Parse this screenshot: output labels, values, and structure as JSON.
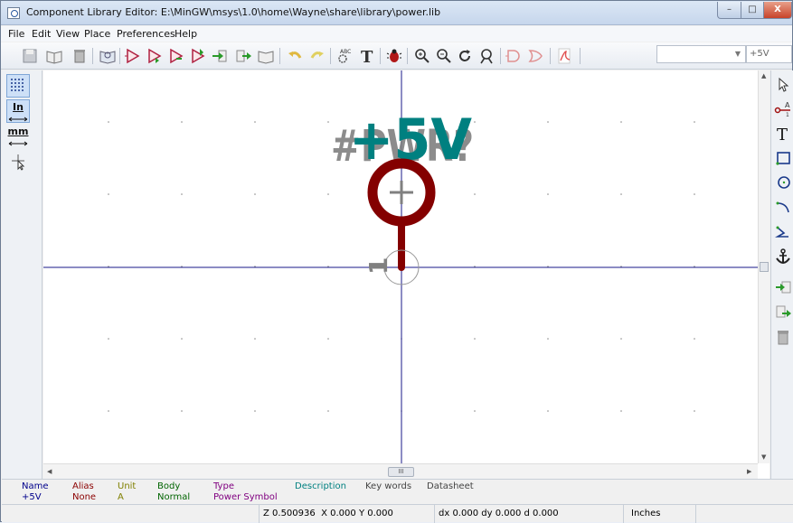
{
  "window": {
    "title": "Component Library Editor: E:\\MinGW\\msys\\1.0\\home\\Wayne\\share\\library\\power.lib",
    "controls": [
      "–",
      "□",
      "X"
    ]
  },
  "menu": [
    "File",
    "Edit",
    "View",
    "Place",
    "Preferences",
    "Help"
  ],
  "toolbar": {
    "icons": [
      "save-library-icon",
      "open-library-icon",
      "delete-part-icon",
      "library-browser-icon",
      "new-part-icon",
      "import-part-icon",
      "export-part-icon",
      "save-part-icon",
      "import-arrow-icon",
      "export-arrow-icon",
      "save-current-icon",
      "undo-icon",
      "redo-icon",
      "edit-fields-icon",
      "text-icon",
      "bug-check-icon",
      "zoom-in-icon",
      "zoom-out-icon",
      "redraw-icon",
      "zoom-fit-icon",
      "deMorgan-normal-icon",
      "deMorgan-convert-icon",
      "pdf-doc-icon"
    ],
    "part_select": "",
    "alias_select": "+5V",
    "abc_label": "ABC"
  },
  "left_toolbar": {
    "items": [
      {
        "icon": "grid-toggle-icon",
        "active": true
      },
      {
        "icon": "inch-units-icon",
        "label": "In",
        "active": true
      },
      {
        "icon": "mm-units-icon",
        "label": "mm",
        "active": false
      },
      {
        "icon": "cursor-shape-icon",
        "active": false
      }
    ]
  },
  "right_toolbar": {
    "icons": [
      "select-arrow-icon",
      "add-pin-icon",
      "add-text-icon",
      "add-rectangle-icon",
      "add-circle-icon",
      "add-arc-icon",
      "add-polyline-icon",
      "set-anchor-icon",
      "import-drawing-icon",
      "export-drawing-icon",
      "delete-item-icon"
    ],
    "text_glyph": "T",
    "pin_glyph": "A",
    "pin_number": "1"
  },
  "canvas": {
    "value_text": "+5V",
    "reference_text": "#PWR?",
    "pin_number": "1",
    "colors": {
      "value": "#008080",
      "body": "#840000",
      "reference": "#808080",
      "axis": "#1a1a8a",
      "grid": "#888888"
    }
  },
  "message_panel": {
    "columns": [
      {
        "header": "Name",
        "value": "+5V",
        "header_color": "#00008b",
        "value_color": "#00008b"
      },
      {
        "header": "Alias",
        "value": "None",
        "header_color": "#8b0000",
        "value_color": "#8b0000"
      },
      {
        "header": "Unit",
        "value": "A",
        "header_color": "#808000",
        "value_color": "#808000"
      },
      {
        "header": "Body",
        "value": "Normal",
        "header_color": "#006400",
        "value_color": "#006400"
      },
      {
        "header": "Type",
        "value": "Power Symbol",
        "header_color": "#800080",
        "value_color": "#800080"
      },
      {
        "header": "Description",
        "value": "",
        "header_color": "#008080",
        "value_color": "#008080"
      },
      {
        "header": "Key words",
        "value": "",
        "header_color": "#444444",
        "value_color": "#444444"
      },
      {
        "header": "Datasheet",
        "value": "",
        "header_color": "#444444",
        "value_color": "#444444"
      }
    ]
  },
  "status_bar": {
    "zoom": "Z 0.500936",
    "xy": "X 0.000  Y 0.000",
    "delta": "dx 0.000  dy 0.000  d 0.000",
    "units": "Inches"
  },
  "scrollbar": {
    "thumb_glyph": "III"
  }
}
